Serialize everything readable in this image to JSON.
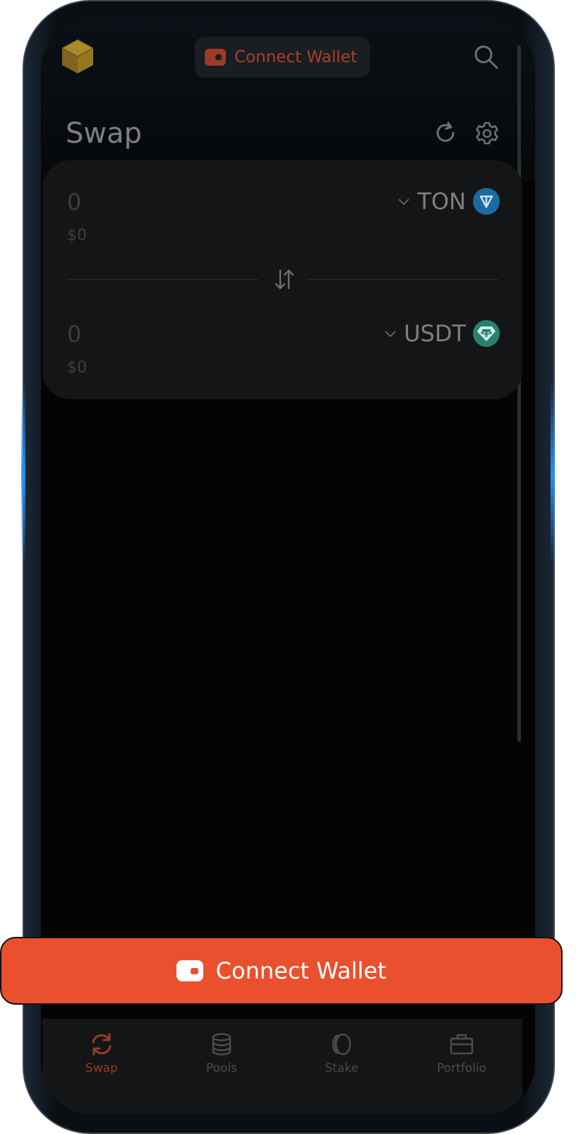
{
  "header": {
    "connect_wallet_label": "Connect Wallet",
    "logo_icon": "cube-logo-icon",
    "search_icon": "search-icon"
  },
  "swap": {
    "title": "Swap",
    "refresh_icon": "refresh-icon",
    "settings_icon": "gear-icon",
    "from": {
      "amount": "0",
      "usd_value": "$0",
      "token": "TON",
      "token_icon": "ton-icon"
    },
    "to": {
      "amount": "0",
      "usd_value": "$0",
      "token": "USDT",
      "token_icon": "usdt-icon"
    },
    "switch_icon": "swap-arrows-icon"
  },
  "connect_bar": {
    "label": "Connect Wallet",
    "icon": "wallet-icon"
  },
  "nav": {
    "items": [
      {
        "label": "Swap",
        "icon": "swap-icon",
        "active": true
      },
      {
        "label": "Pools",
        "icon": "database-icon",
        "active": false
      },
      {
        "label": "Stake",
        "icon": "coin-icon",
        "active": false
      },
      {
        "label": "Portfolio",
        "icon": "briefcase-icon",
        "active": false
      }
    ]
  },
  "colors": {
    "accent": "#ea502d",
    "accent_dim": "#993a26",
    "background": "#040404",
    "card": "#141516",
    "ton_blue": "#1d6aa3",
    "usdt_green": "#26826f"
  }
}
